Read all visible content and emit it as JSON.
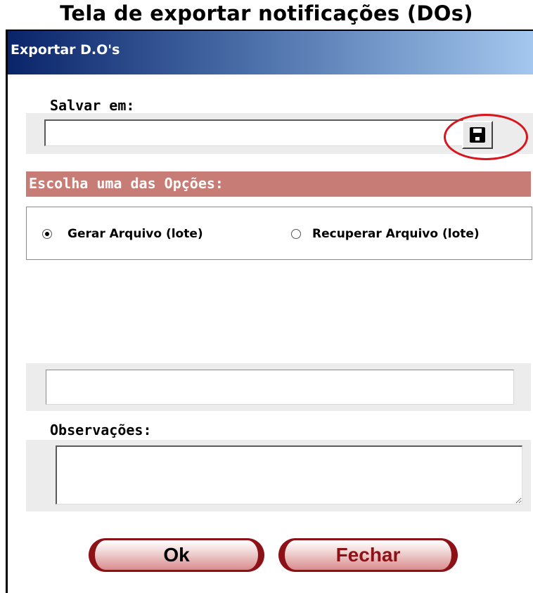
{
  "page": {
    "title": "Tela de exportar notificações (DOs)"
  },
  "window": {
    "title": "Exportar D.O's"
  },
  "save": {
    "label": "Salvar em:",
    "path_value": "",
    "button_icon": "floppy-disk-icon"
  },
  "options": {
    "header": "Escolha uma das Opções:",
    "items": [
      {
        "label": "Gerar Arquivo (lote)",
        "checked": true
      },
      {
        "label": "Recuperar Arquivo (lote)",
        "checked": false
      }
    ]
  },
  "status": {
    "value": ""
  },
  "observations": {
    "label": "Observações:",
    "value": ""
  },
  "buttons": {
    "ok": "Ok",
    "close": "Fechar"
  },
  "colors": {
    "titlebar_start": "#0a246a",
    "titlebar_end": "#a6caf0",
    "options_header": "#c87c76",
    "highlight_circle": "#d8141c",
    "button_accent": "#8c1218"
  }
}
